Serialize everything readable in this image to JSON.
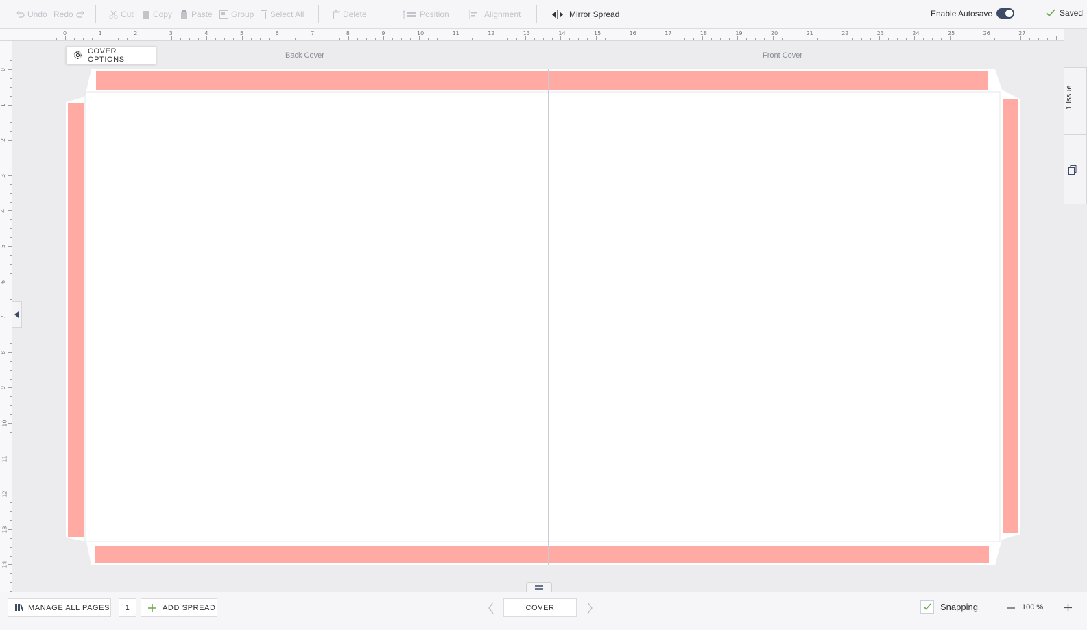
{
  "toolbar": {
    "undo": "Undo",
    "redo": "Redo",
    "cut": "Cut",
    "copy": "Copy",
    "paste": "Paste",
    "group": "Group",
    "select_all": "Select All",
    "delete": "Delete",
    "position": "Position",
    "alignment": "Alignment",
    "mirror_spread": "Mirror Spread",
    "enable_autosave": "Enable Autosave",
    "autosave_on": true,
    "saved": "Saved"
  },
  "rulers": {
    "horizontal": [
      "0",
      "1",
      "2",
      "3",
      "4",
      "5",
      "6",
      "7",
      "8",
      "9",
      "10",
      "11",
      "12",
      "13",
      "14",
      "15",
      "16",
      "17",
      "18",
      "19",
      "20",
      "21",
      "22",
      "23",
      "24",
      "25",
      "26",
      "27"
    ],
    "vertical": [
      "0",
      "1",
      "2",
      "3",
      "4",
      "5",
      "6",
      "7",
      "8",
      "9",
      "10",
      "11",
      "12",
      "13",
      "14"
    ]
  },
  "canvas": {
    "cover_options": "COVER OPTIONS",
    "back_cover": "Back Cover",
    "front_cover": "Front Cover"
  },
  "side_panel": {
    "issue_tab": "1 Issue"
  },
  "bottom": {
    "manage_all_pages": "MANAGE ALL PAGES",
    "page_number": "1",
    "add_spread": "ADD SPREAD",
    "current_spread": "COVER",
    "snapping": "Snapping",
    "snapping_checked": true,
    "zoom": "100 %"
  },
  "colors": {
    "bleed": "#ffaaa2",
    "accent_green": "#6aa84f",
    "toggle": "#3d4b66"
  }
}
